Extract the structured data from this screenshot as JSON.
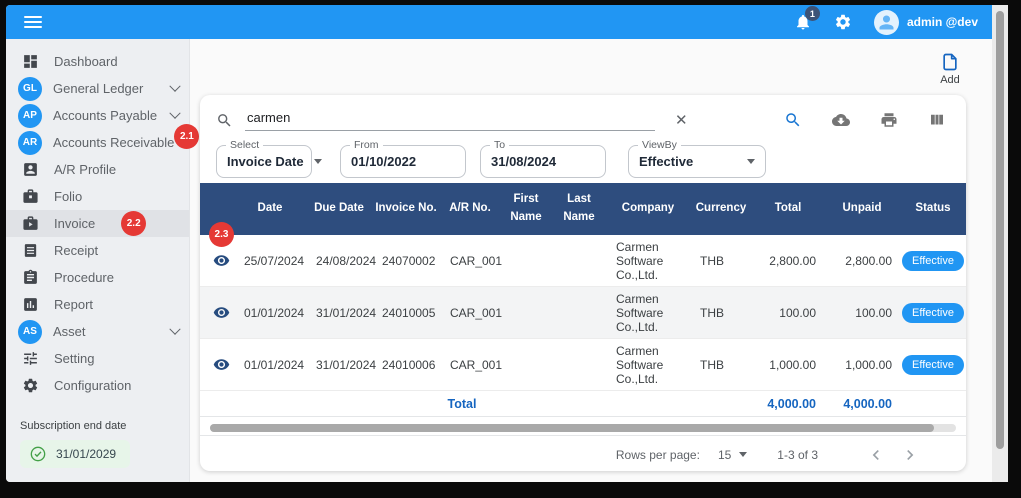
{
  "topbar": {
    "user": "admin @dev",
    "notification_count": "1",
    "icons": [
      "menu-icon",
      "bell-icon",
      "gear-icon",
      "avatar"
    ]
  },
  "sidebar": {
    "items": [
      {
        "label": "Dashboard",
        "icon": "dashboard-icon"
      },
      {
        "label": "General Ledger",
        "abbr": "GL",
        "expandable": true
      },
      {
        "label": "Accounts Payable",
        "abbr": "AP",
        "expandable": true
      },
      {
        "label": "Accounts Receivable",
        "abbr": "AR",
        "badge": "2.1"
      },
      {
        "label": "A/R Profile",
        "icon": "profile-icon"
      },
      {
        "label": "Folio",
        "icon": "folio-icon"
      },
      {
        "label": "Invoice",
        "icon": "invoice-icon",
        "badge": "2.2",
        "active": true
      },
      {
        "label": "Receipt",
        "icon": "receipt-icon"
      },
      {
        "label": "Procedure",
        "icon": "procedure-icon"
      },
      {
        "label": "Report",
        "icon": "report-icon"
      },
      {
        "label": "Asset",
        "abbr": "AS",
        "expandable": true
      },
      {
        "label": "Setting",
        "icon": "sliders-icon"
      },
      {
        "label": "Configuration",
        "icon": "gear-icon"
      }
    ],
    "subscription": {
      "label": "Subscription end date",
      "date": "31/01/2029",
      "icon": "check-circle-icon"
    }
  },
  "toolbar": {
    "add_label": "Add",
    "add_icon": "document-add-icon",
    "action_icons": [
      "search-icon",
      "cloud-download-icon",
      "printer-icon",
      "columns-icon"
    ]
  },
  "search": {
    "value": "carmen",
    "clear_icon": "clear-icon"
  },
  "filters": {
    "select": {
      "label": "Select",
      "value": "Invoice Date"
    },
    "from": {
      "label": "From",
      "value": "01/10/2022"
    },
    "to": {
      "label": "To",
      "value": "31/08/2024"
    },
    "viewby": {
      "label": "ViewBy",
      "value": "Effective"
    }
  },
  "table": {
    "columns": [
      "",
      "Date",
      "Due Date",
      "Invoice No.",
      "A/R No.",
      "First Name",
      "Last Name",
      "Company",
      "Currency",
      "Total",
      "Unpaid",
      "Status"
    ],
    "row_badge": "2.3",
    "rows": [
      {
        "date": "25/07/2024",
        "due_date": "24/08/2024",
        "invoice_no": "24070002",
        "ar_no": "CAR_001",
        "first_name": "",
        "last_name": "",
        "company": "Carmen Software Co.,Ltd.",
        "currency": "THB",
        "total": "2,800.00",
        "unpaid": "2,800.00",
        "status": "Effective"
      },
      {
        "date": "01/01/2024",
        "due_date": "31/01/2024",
        "invoice_no": "24010005",
        "ar_no": "CAR_001",
        "first_name": "",
        "last_name": "",
        "company": "Carmen Software Co.,Ltd.",
        "currency": "THB",
        "total": "100.00",
        "unpaid": "100.00",
        "status": "Effective"
      },
      {
        "date": "01/01/2024",
        "due_date": "31/01/2024",
        "invoice_no": "24010006",
        "ar_no": "CAR_001",
        "first_name": "",
        "last_name": "",
        "company": "Carmen Software Co.,Ltd.",
        "currency": "THB",
        "total": "1,000.00",
        "unpaid": "1,000.00",
        "status": "Effective"
      }
    ],
    "summary": {
      "label": "Total",
      "total": "4,000.00",
      "unpaid": "4,000.00"
    }
  },
  "pagination": {
    "rows_per_page_label": "Rows per page:",
    "rows_per_page": "15",
    "range": "1-3 of 3"
  },
  "colors": {
    "topbar_blue": "#2196f3",
    "table_header_navy": "#2e4d7e",
    "badge_red": "#e53935",
    "status_badge_blue": "#2196f3",
    "totals_blue": "#1565c0",
    "subscription_green": "#43a047"
  }
}
